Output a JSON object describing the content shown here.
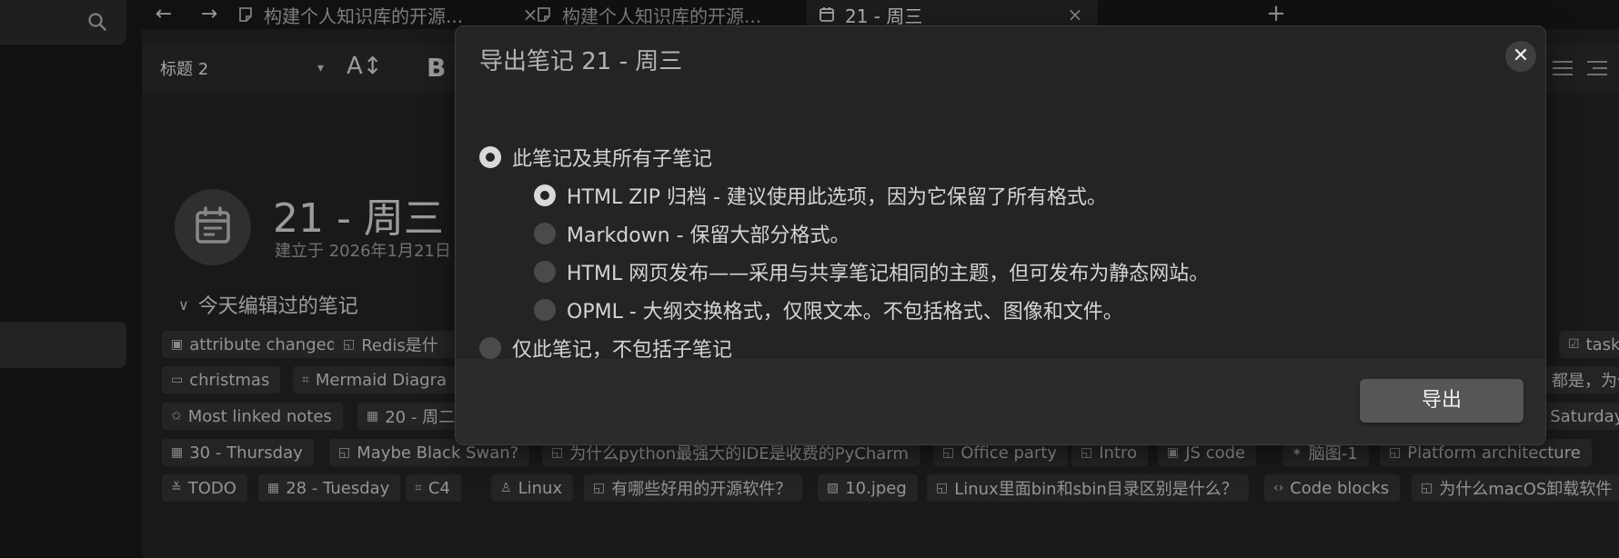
{
  "tabs": [
    {
      "title": "构建个人知识库的开源...",
      "icon": "note-icon",
      "active": false
    },
    {
      "title": "构建个人知识库的开源...",
      "icon": "note-icon",
      "active": false
    },
    {
      "title": "21 - 周三",
      "icon": "calendar-icon",
      "active": true
    }
  ],
  "tab_close_glyph": "×",
  "new_tab_glyph": "+",
  "toolbar": {
    "heading_select": "标题 2",
    "font_size_glyph": "A↕",
    "bold_glyph": "B"
  },
  "note": {
    "title": "21 - 周三",
    "created": "建立于 2026年1月21日"
  },
  "edited_today": {
    "label": "今天编辑过的笔记",
    "chips": [
      [
        "attribute changed",
        "Redis是什",
        "",
        "task"
      ],
      [
        "christmas",
        "Mermaid Diagra",
        "都是，为什"
      ],
      [
        "Most linked notes",
        "20 - 周二",
        "Saturday"
      ],
      [
        "30 - Thursday",
        "Maybe Black Swan?",
        "为什么python最强大的IDE是收费的PyCharm",
        "Office party",
        "Intro",
        "JS code",
        "脑图-1",
        "Platform architecture"
      ],
      [
        "TODO",
        "28 - Tuesday",
        "C4",
        "Linux",
        "有哪些好用的开源软件？",
        "10.jpeg",
        "Linux里面bin和sbin目录区别是什么？",
        "Code blocks",
        "为什么macOS卸载软件"
      ]
    ]
  },
  "modal": {
    "title": "导出笔记 21 - 周三",
    "close_glyph": "✕",
    "options": {
      "subtree": "此笔记及其所有子笔记",
      "html_zip": "HTML ZIP 归档 - 建议使用此选项，因为它保留了所有格式。",
      "markdown": "Markdown - 保留大部分格式。",
      "html_site": "HTML 网页发布——采用与共享笔记相同的主题，但可发布为静态网站。",
      "opml": "OPML - 大纲交换格式，仅限文本。不包括格式、图像和文件。",
      "single": "仅此笔记，不包括子笔记"
    },
    "selected": {
      "scope": "subtree",
      "format": "html_zip"
    },
    "export_label": "导出"
  }
}
